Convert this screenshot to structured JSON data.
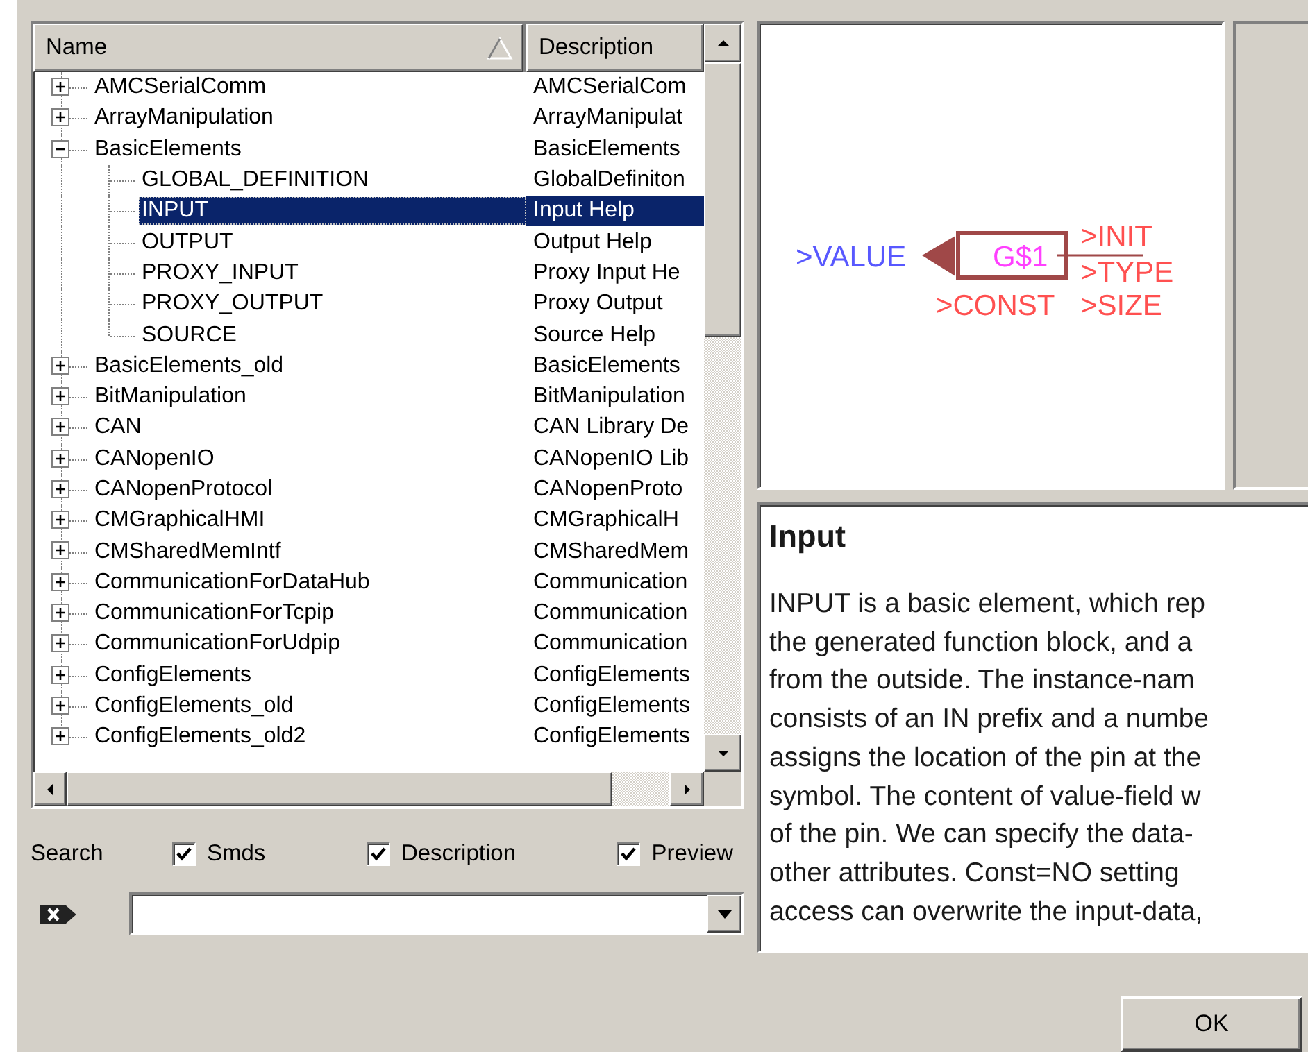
{
  "tree": {
    "columns": [
      {
        "label": "Name",
        "sorted": true
      },
      {
        "label": "Description"
      }
    ],
    "rows": [
      {
        "name": "AMCSerialComm",
        "description": "AMCSerialCom",
        "expanded": false,
        "selected": false
      },
      {
        "name": "ArrayManipulation",
        "description": "ArrayManipulat",
        "expanded": false,
        "selected": false
      },
      {
        "name": "BasicElements",
        "description": "BasicElements",
        "expanded": true,
        "selected": false,
        "children": [
          {
            "name": "GLOBAL_DEFINITION",
            "description": "GlobalDefiniton",
            "selected": false
          },
          {
            "name": "INPUT",
            "description": "Input Help",
            "selected": true
          },
          {
            "name": "OUTPUT",
            "description": "Output Help",
            "selected": false
          },
          {
            "name": "PROXY_INPUT",
            "description": "Proxy Input He",
            "selected": false
          },
          {
            "name": "PROXY_OUTPUT",
            "description": "Proxy Output",
            "selected": false
          },
          {
            "name": "SOURCE",
            "description": "Source Help",
            "selected": false
          }
        ]
      },
      {
        "name": "BasicElements_old",
        "description": "BasicElements",
        "expanded": false,
        "selected": false
      },
      {
        "name": "BitManipulation",
        "description": "BitManipulation",
        "expanded": false,
        "selected": false
      },
      {
        "name": "CAN",
        "description": "CAN Library De",
        "expanded": false,
        "selected": false
      },
      {
        "name": "CANopenIO",
        "description": "CANopenIO Lib",
        "expanded": false,
        "selected": false
      },
      {
        "name": "CANopenProtocol",
        "description": "CANopenProto",
        "expanded": false,
        "selected": false
      },
      {
        "name": "CMGraphicalHMI",
        "description": "CMGraphicalH",
        "expanded": false,
        "selected": false
      },
      {
        "name": "CMSharedMemIntf",
        "description": "CMSharedMem",
        "expanded": false,
        "selected": false
      },
      {
        "name": "CommunicationForDataHub",
        "description": "Communication",
        "expanded": false,
        "selected": false
      },
      {
        "name": "CommunicationForTcpip",
        "description": "Communication",
        "expanded": false,
        "selected": false
      },
      {
        "name": "CommunicationForUdpip",
        "description": "Communication",
        "expanded": false,
        "selected": false
      },
      {
        "name": "ConfigElements",
        "description": "ConfigElements",
        "expanded": false,
        "selected": false
      },
      {
        "name": "ConfigElements_old",
        "description": "ConfigElements",
        "expanded": false,
        "selected": false
      },
      {
        "name": "ConfigElements_old2",
        "description": "ConfigElements",
        "expanded": false,
        "selected": false
      }
    ]
  },
  "search": {
    "label": "Search",
    "options": [
      {
        "label": "Smds",
        "checked": true
      },
      {
        "label": "Description",
        "checked": true
      },
      {
        "label": "Preview",
        "checked": true
      }
    ]
  },
  "preview": {
    "value_pin": ">VALUE",
    "instance": "G$1",
    "attributes": [
      ">INIT",
      ">TYPE",
      ">CONST",
      ">SIZE"
    ]
  },
  "help": {
    "title": "Input",
    "lines": [
      "INPUT is a basic element, which rep",
      "the generated function block, and a",
      "from the outside. The instance-nam",
      "consists of an IN prefix and a numbe",
      "assigns the location of the pin at the",
      "symbol. The content of value-field w",
      "of the pin. We can specify the data-",
      "other attributes. Const=NO setting",
      "access can overwrite the input-data,"
    ]
  },
  "buttons": [
    "OK"
  ]
}
